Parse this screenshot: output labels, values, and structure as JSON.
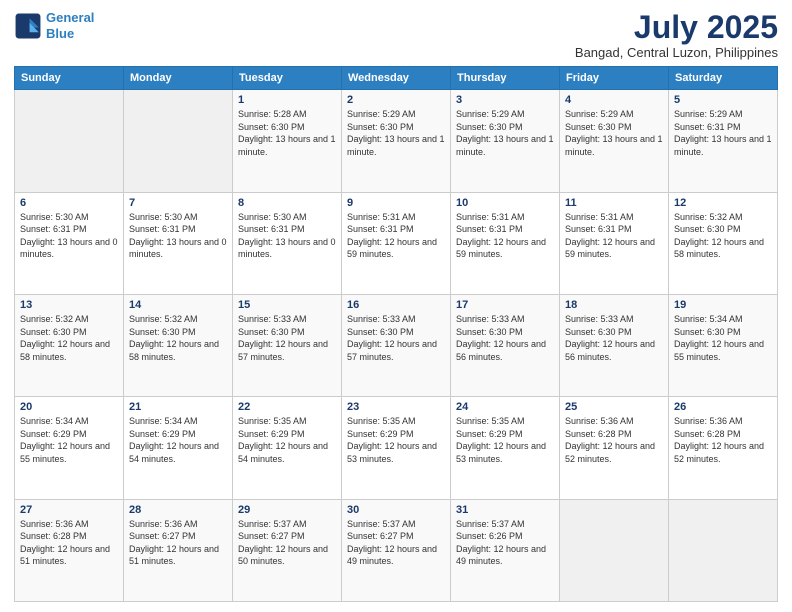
{
  "logo": {
    "line1": "General",
    "line2": "Blue"
  },
  "header": {
    "month": "July 2025",
    "location": "Bangad, Central Luzon, Philippines"
  },
  "weekdays": [
    "Sunday",
    "Monday",
    "Tuesday",
    "Wednesday",
    "Thursday",
    "Friday",
    "Saturday"
  ],
  "weeks": [
    [
      {
        "day": "",
        "info": ""
      },
      {
        "day": "",
        "info": ""
      },
      {
        "day": "1",
        "info": "Sunrise: 5:28 AM\nSunset: 6:30 PM\nDaylight: 13 hours and 1 minute."
      },
      {
        "day": "2",
        "info": "Sunrise: 5:29 AM\nSunset: 6:30 PM\nDaylight: 13 hours and 1 minute."
      },
      {
        "day": "3",
        "info": "Sunrise: 5:29 AM\nSunset: 6:30 PM\nDaylight: 13 hours and 1 minute."
      },
      {
        "day": "4",
        "info": "Sunrise: 5:29 AM\nSunset: 6:30 PM\nDaylight: 13 hours and 1 minute."
      },
      {
        "day": "5",
        "info": "Sunrise: 5:29 AM\nSunset: 6:31 PM\nDaylight: 13 hours and 1 minute."
      }
    ],
    [
      {
        "day": "6",
        "info": "Sunrise: 5:30 AM\nSunset: 6:31 PM\nDaylight: 13 hours and 0 minutes."
      },
      {
        "day": "7",
        "info": "Sunrise: 5:30 AM\nSunset: 6:31 PM\nDaylight: 13 hours and 0 minutes."
      },
      {
        "day": "8",
        "info": "Sunrise: 5:30 AM\nSunset: 6:31 PM\nDaylight: 13 hours and 0 minutes."
      },
      {
        "day": "9",
        "info": "Sunrise: 5:31 AM\nSunset: 6:31 PM\nDaylight: 12 hours and 59 minutes."
      },
      {
        "day": "10",
        "info": "Sunrise: 5:31 AM\nSunset: 6:31 PM\nDaylight: 12 hours and 59 minutes."
      },
      {
        "day": "11",
        "info": "Sunrise: 5:31 AM\nSunset: 6:31 PM\nDaylight: 12 hours and 59 minutes."
      },
      {
        "day": "12",
        "info": "Sunrise: 5:32 AM\nSunset: 6:30 PM\nDaylight: 12 hours and 58 minutes."
      }
    ],
    [
      {
        "day": "13",
        "info": "Sunrise: 5:32 AM\nSunset: 6:30 PM\nDaylight: 12 hours and 58 minutes."
      },
      {
        "day": "14",
        "info": "Sunrise: 5:32 AM\nSunset: 6:30 PM\nDaylight: 12 hours and 58 minutes."
      },
      {
        "day": "15",
        "info": "Sunrise: 5:33 AM\nSunset: 6:30 PM\nDaylight: 12 hours and 57 minutes."
      },
      {
        "day": "16",
        "info": "Sunrise: 5:33 AM\nSunset: 6:30 PM\nDaylight: 12 hours and 57 minutes."
      },
      {
        "day": "17",
        "info": "Sunrise: 5:33 AM\nSunset: 6:30 PM\nDaylight: 12 hours and 56 minutes."
      },
      {
        "day": "18",
        "info": "Sunrise: 5:33 AM\nSunset: 6:30 PM\nDaylight: 12 hours and 56 minutes."
      },
      {
        "day": "19",
        "info": "Sunrise: 5:34 AM\nSunset: 6:30 PM\nDaylight: 12 hours and 55 minutes."
      }
    ],
    [
      {
        "day": "20",
        "info": "Sunrise: 5:34 AM\nSunset: 6:29 PM\nDaylight: 12 hours and 55 minutes."
      },
      {
        "day": "21",
        "info": "Sunrise: 5:34 AM\nSunset: 6:29 PM\nDaylight: 12 hours and 54 minutes."
      },
      {
        "day": "22",
        "info": "Sunrise: 5:35 AM\nSunset: 6:29 PM\nDaylight: 12 hours and 54 minutes."
      },
      {
        "day": "23",
        "info": "Sunrise: 5:35 AM\nSunset: 6:29 PM\nDaylight: 12 hours and 53 minutes."
      },
      {
        "day": "24",
        "info": "Sunrise: 5:35 AM\nSunset: 6:29 PM\nDaylight: 12 hours and 53 minutes."
      },
      {
        "day": "25",
        "info": "Sunrise: 5:36 AM\nSunset: 6:28 PM\nDaylight: 12 hours and 52 minutes."
      },
      {
        "day": "26",
        "info": "Sunrise: 5:36 AM\nSunset: 6:28 PM\nDaylight: 12 hours and 52 minutes."
      }
    ],
    [
      {
        "day": "27",
        "info": "Sunrise: 5:36 AM\nSunset: 6:28 PM\nDaylight: 12 hours and 51 minutes."
      },
      {
        "day": "28",
        "info": "Sunrise: 5:36 AM\nSunset: 6:27 PM\nDaylight: 12 hours and 51 minutes."
      },
      {
        "day": "29",
        "info": "Sunrise: 5:37 AM\nSunset: 6:27 PM\nDaylight: 12 hours and 50 minutes."
      },
      {
        "day": "30",
        "info": "Sunrise: 5:37 AM\nSunset: 6:27 PM\nDaylight: 12 hours and 49 minutes."
      },
      {
        "day": "31",
        "info": "Sunrise: 5:37 AM\nSunset: 6:26 PM\nDaylight: 12 hours and 49 minutes."
      },
      {
        "day": "",
        "info": ""
      },
      {
        "day": "",
        "info": ""
      }
    ]
  ]
}
